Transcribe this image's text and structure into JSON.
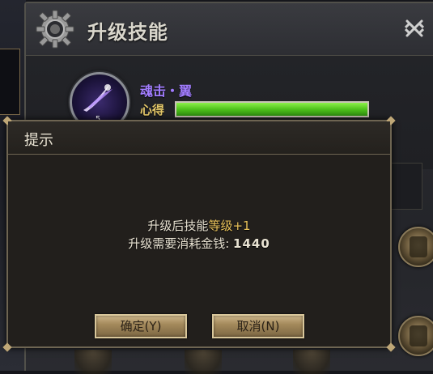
{
  "skill_window": {
    "title": "升级技能"
  },
  "skill": {
    "name": "魂击・翼",
    "level": "5",
    "xinde_label": "心得",
    "progress_fraction": 1.0
  },
  "dialog": {
    "title": "提示",
    "message_line1_prefix": "升级后技能",
    "message_line1_highlight": "等级+1",
    "message_line2_prefix": "升级需要消耗金钱: ",
    "message_line2_amount": "1440",
    "confirm_label": "确定(Y)",
    "cancel_label": "取消(N)"
  },
  "colors": {
    "skill_name": "#a27dff",
    "xinde_label": "#e6c96a",
    "highlight_gold": "#e9c25a",
    "progress_green": "#4fc21c",
    "button_gold": "#a48a5c"
  },
  "icons": {
    "header": "gear-icon",
    "close": "crossed-swords-close-icon",
    "skill": "soul-strike-wing-icon",
    "slot": "skill-slot-icon"
  }
}
